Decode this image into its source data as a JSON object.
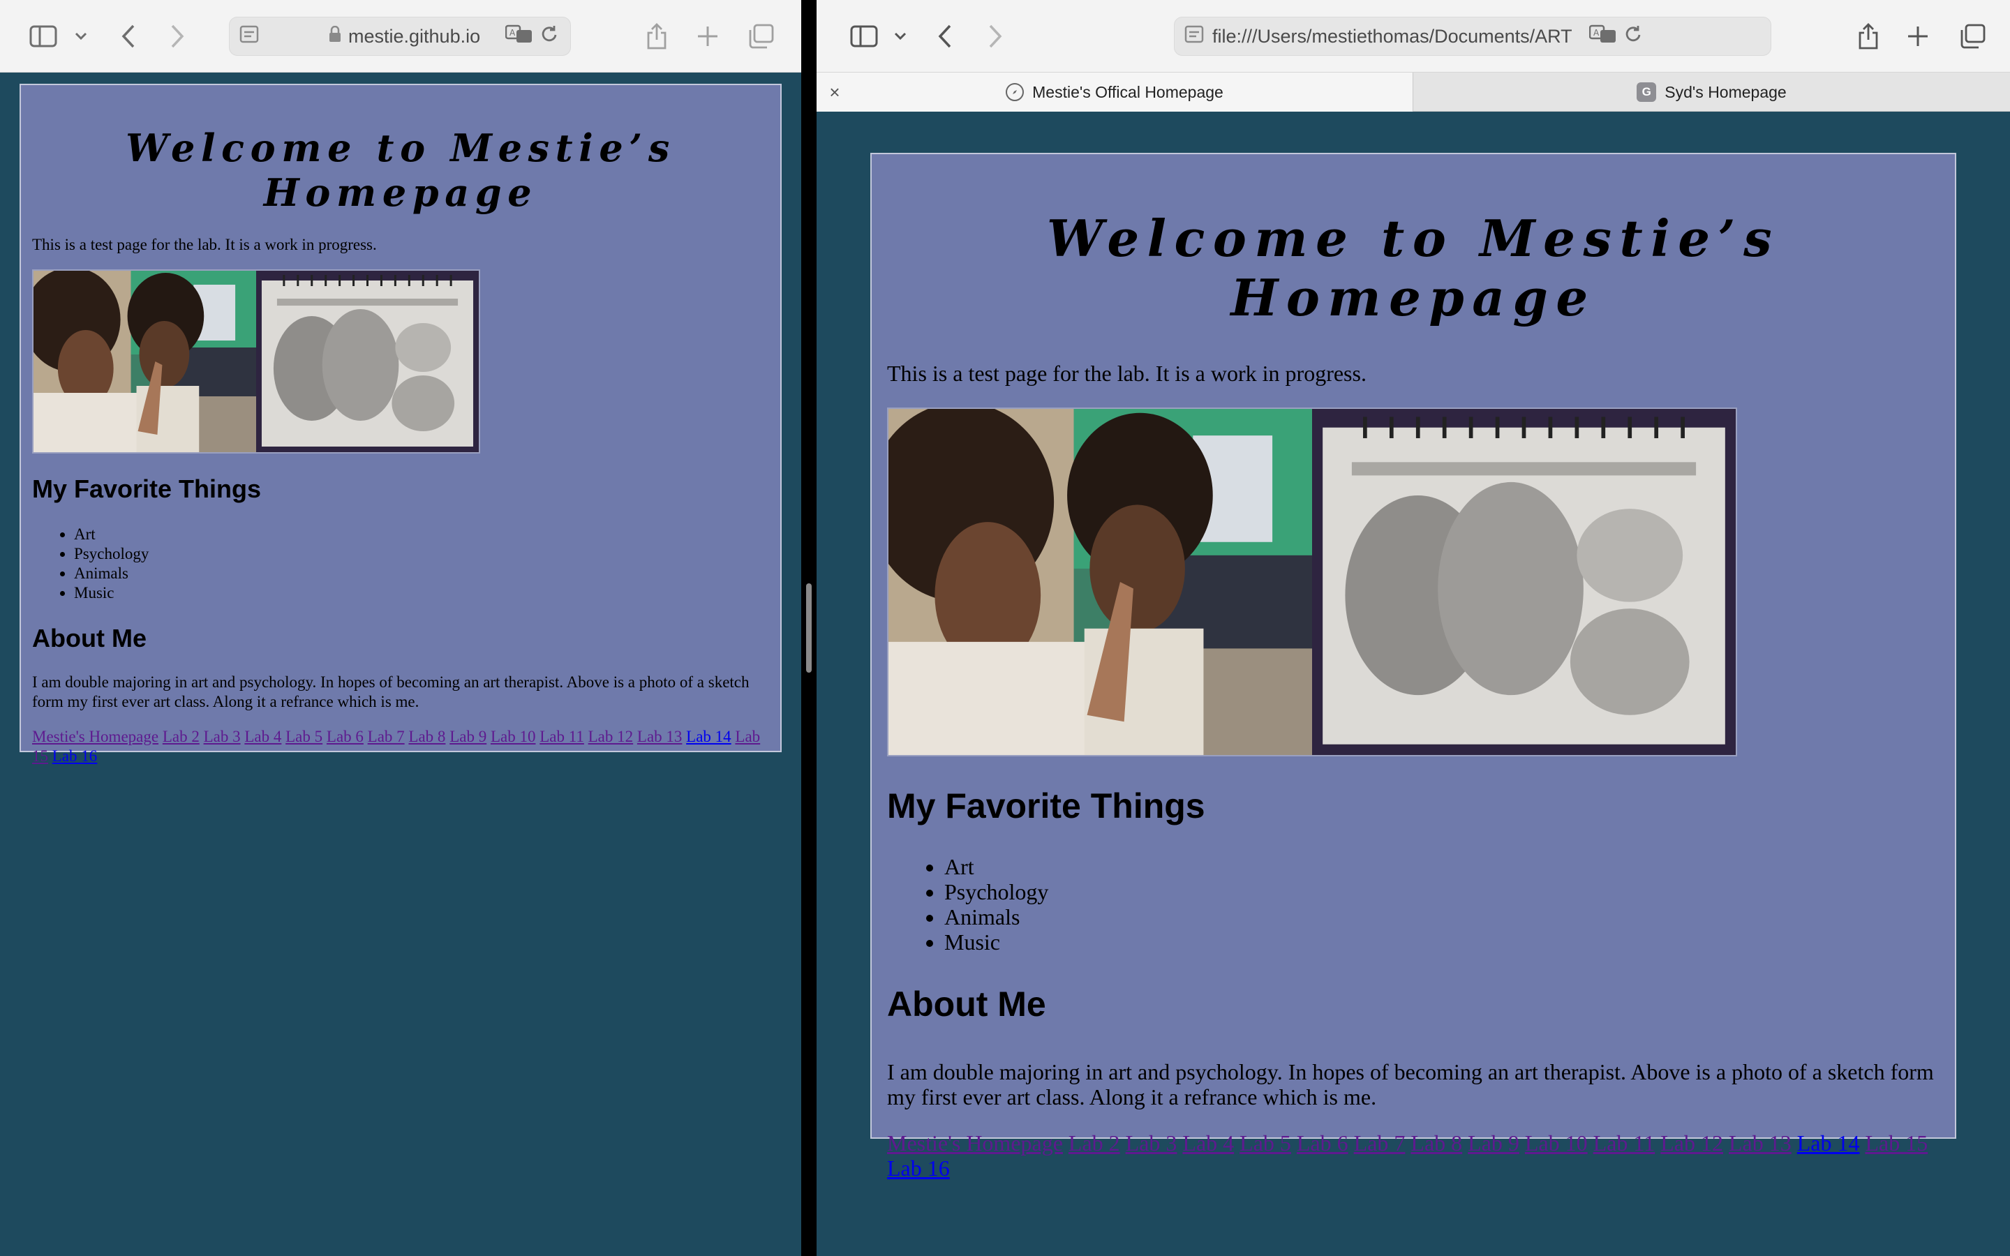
{
  "left_window": {
    "address": "mestie.github.io"
  },
  "right_window": {
    "address": "file:///Users/mestiethomas/Documents/ART",
    "tabs": [
      {
        "label": "Mestie's Offical Homepage",
        "active": true,
        "icon": "compass-icon"
      },
      {
        "label": "Syd's Homepage",
        "active": false,
        "icon": "letter-g-icon",
        "icon_letter": "G"
      }
    ]
  },
  "page": {
    "title": "Welcome to Mestie’s Homepage",
    "intro": "This is a test page for the lab. It is a work in progress.",
    "favorites_heading": "My Favorite Things",
    "favorites": [
      "Art",
      "Psychology",
      "Animals",
      "Music"
    ],
    "about_heading": "About Me",
    "about_text": "I am double majoring in art and psychology. In hopes of becoming an art therapist. Above is a photo of a sketch form my first ever art class. Along it a refrance which is me.",
    "links": [
      {
        "label": "Mestie's Homepage",
        "visited": true
      },
      {
        "label": "Lab 2",
        "visited": true
      },
      {
        "label": "Lab 3",
        "visited": true
      },
      {
        "label": "Lab 4",
        "visited": true
      },
      {
        "label": "Lab 5",
        "visited": true
      },
      {
        "label": "Lab 6",
        "visited": true
      },
      {
        "label": "Lab 7",
        "visited": true
      },
      {
        "label": "Lab 8",
        "visited": true
      },
      {
        "label": "Lab 9",
        "visited": true
      },
      {
        "label": "Lab 10",
        "visited": true
      },
      {
        "label": "Lab 11",
        "visited": true
      },
      {
        "label": "Lab 12",
        "visited": true
      },
      {
        "label": "Lab 13",
        "visited": true
      },
      {
        "label": "Lab 14",
        "visited": false
      },
      {
        "label": "Lab 15",
        "visited": true
      },
      {
        "label": "Lab 16",
        "visited": false
      }
    ]
  },
  "colors": {
    "desktop_bg": "#1e4a5e",
    "page_bg": "#6f7aab",
    "visited_link": "#5e1a8f",
    "unvisited_link": "#0000ee"
  }
}
